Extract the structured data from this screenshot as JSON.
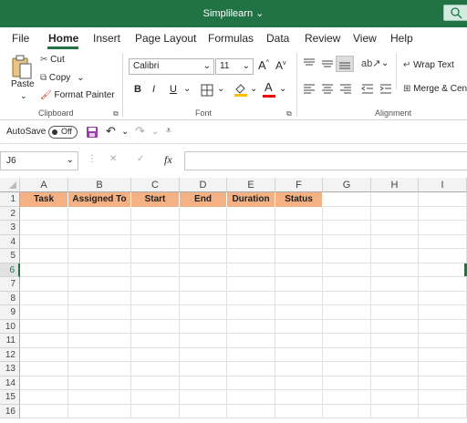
{
  "window": {
    "title": "Simplilearn ⌄"
  },
  "tabs": [
    "File",
    "Home",
    "Insert",
    "Page Layout",
    "Formulas",
    "Data",
    "Review",
    "View",
    "Help"
  ],
  "clipboard": {
    "paste": "Paste",
    "cut": "Cut",
    "copy": "Copy",
    "format_painter": "Format Painter",
    "group_label": "Clipboard"
  },
  "font": {
    "name": "Calibri",
    "size": "11",
    "bold": "B",
    "italic": "I",
    "underline": "U",
    "font_color_glyph": "A",
    "group_label": "Font"
  },
  "alignment": {
    "wrap_text": "Wrap Text",
    "merge": "Merge & Cen",
    "group_label": "Alignment"
  },
  "qat": {
    "autosave": "AutoSave",
    "autosave_state": "Off"
  },
  "formula_bar": {
    "name_box": "J6",
    "fx": "fx",
    "cancel": "✕",
    "enter": "✓"
  },
  "grid": {
    "columns": [
      "A",
      "B",
      "C",
      "D",
      "E",
      "F",
      "G",
      "H",
      "I"
    ],
    "rows": [
      "1",
      "2",
      "3",
      "4",
      "5",
      "6",
      "7",
      "8",
      "9",
      "10",
      "11",
      "12",
      "13",
      "14",
      "15",
      "16"
    ],
    "selected_row": "6",
    "header_row": [
      "Task",
      "Assigned To",
      "Start",
      "End",
      "Duration",
      "Status"
    ],
    "header_fill": "#f4b183"
  },
  "colors": {
    "brand": "#217346"
  }
}
